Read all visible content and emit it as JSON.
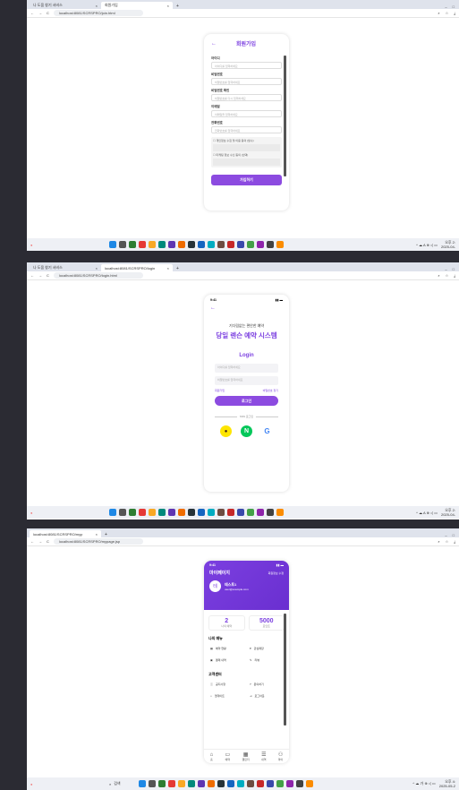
{
  "windows": [
    {
      "tabs": [
        "나 도움 창기 서비스",
        "회원가입"
      ],
      "url": "localhost:8081/SCRSPRO/join.html"
    },
    {
      "tabs": [
        "나 도움 창기 서비스",
        "localhost:8081/SCRSPRO/login"
      ],
      "url": "localhost:8081/SCRSPRO/login.html"
    },
    {
      "tabs": [
        "localhost:8081/SCRSPRO/myp"
      ],
      "url": "localhost:8081/SCRSPRO/mypage.jsp"
    }
  ],
  "join": {
    "title": "회원가입",
    "fields": [
      {
        "label": "아이디",
        "placeholder": "아이디를 입력하세요"
      },
      {
        "label": "비밀번호",
        "placeholder": "비밀번호를 입력하세요"
      },
      {
        "label": "비밀번호 확인",
        "placeholder": "비밀번호를 다시 입력하세요"
      },
      {
        "label": "이메일",
        "placeholder": "이메일을 입력하세요"
      },
      {
        "label": "전화번호",
        "placeholder": "전화번호를 입력하세요"
      }
    ],
    "agree1": "개인정보 수집 및 이용 동의 (필수)",
    "agree2": "마케팅 정보 수신 동의 (선택)",
    "submit": "가입하기"
  },
  "login": {
    "time": "9:41",
    "subtitle": "기다림없는 편안한 예약",
    "title": "당일 렌슨 예약 시스템",
    "heading": "Login",
    "id_placeholder": "아이디를 입력하세요",
    "pw_placeholder": "비밀번호를 입력하세요",
    "signup": "회원가입",
    "find_pw": "비밀번호 찾기",
    "login_btn": "로그인",
    "divider": "SNS 로그인"
  },
  "mypage": {
    "time": "9:41",
    "title": "마이페이지",
    "edit": "회원정보 수정",
    "avatar": "테",
    "name": "테스트1",
    "email": "user@example.com",
    "stat1_value": "2",
    "stat1_label": "나의 예약",
    "stat2_value": "5000",
    "stat2_label": "포인트",
    "menu_title": "나의 메뉴",
    "menu": [
      "예약 현황",
      "관심매장",
      "결제 내역",
      "리뷰"
    ],
    "cs_title": "고객센터",
    "cs": [
      "공지사항",
      "문의하기",
      "업데이트",
      "로그아웃"
    ],
    "nav": [
      "홈",
      "예약",
      "캘린더",
      "내역",
      "마이"
    ]
  },
  "taskbar": {
    "search": "검색",
    "time1": "오후 2:",
    "date1": "2025-04-",
    "time3": "오후 4:",
    "date3": "2025-05-2"
  }
}
